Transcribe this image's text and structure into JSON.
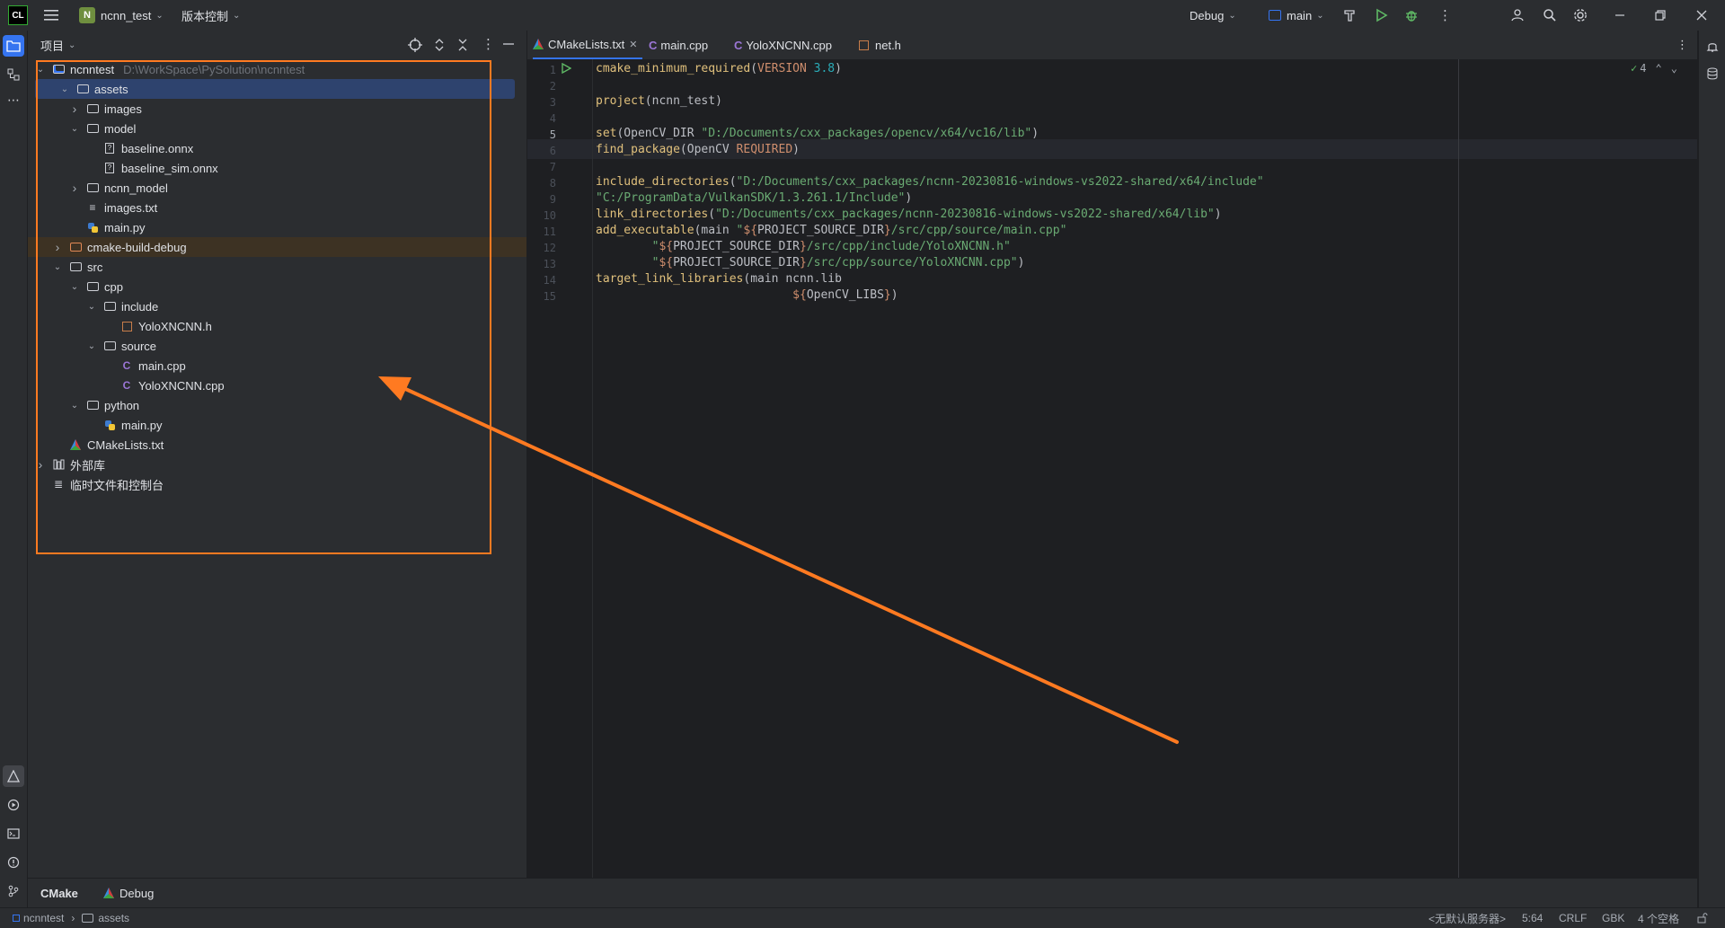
{
  "topbar": {
    "logo": "CL",
    "menu_icon": "hamburger-icon",
    "project_badge": "N",
    "project_name": "ncnn_test",
    "vcs_menu": "版本控制",
    "run_config": "Debug",
    "branch": "main"
  },
  "project_panel": {
    "title": "项目",
    "tree": [
      {
        "label": "ncnntest",
        "hint": "D:\\WorkSpace\\PySolution\\ncnntest",
        "level": 0,
        "arrow": "open",
        "icon": "module-folder"
      },
      {
        "label": "assets",
        "level": 1,
        "arrow": "open",
        "icon": "folder",
        "selected": true
      },
      {
        "label": "images",
        "level": 2,
        "arrow": "closed",
        "icon": "folder"
      },
      {
        "label": "model",
        "level": 2,
        "arrow": "open",
        "icon": "folder"
      },
      {
        "label": "baseline.onnx",
        "level": 3,
        "arrow": "none",
        "icon": "unknown-file"
      },
      {
        "label": "baseline_sim.onnx",
        "level": 3,
        "arrow": "none",
        "icon": "unknown-file"
      },
      {
        "label": "ncnn_model",
        "level": 2,
        "arrow": "closed",
        "icon": "folder"
      },
      {
        "label": "images.txt",
        "level": 2,
        "arrow": "none",
        "icon": "text-file"
      },
      {
        "label": "main.py",
        "level": 2,
        "arrow": "none",
        "icon": "python-file"
      },
      {
        "label": "cmake-build-debug",
        "level": 1,
        "arrow": "closed",
        "icon": "excluded-folder",
        "excluded": true
      },
      {
        "label": "src",
        "level": 1,
        "arrow": "open",
        "icon": "folder"
      },
      {
        "label": "cpp",
        "level": 2,
        "arrow": "open",
        "icon": "folder"
      },
      {
        "label": "include",
        "level": 3,
        "arrow": "open",
        "icon": "folder"
      },
      {
        "label": "YoloXNCNN.h",
        "level": 4,
        "arrow": "none",
        "icon": "header-file"
      },
      {
        "label": "source",
        "level": 3,
        "arrow": "open",
        "icon": "folder"
      },
      {
        "label": "main.cpp",
        "level": 4,
        "arrow": "none",
        "icon": "cpp-file"
      },
      {
        "label": "YoloXNCNN.cpp",
        "level": 4,
        "arrow": "none",
        "icon": "cpp-file"
      },
      {
        "label": "python",
        "level": 2,
        "arrow": "open",
        "icon": "folder"
      },
      {
        "label": "main.py",
        "level": 3,
        "arrow": "none",
        "icon": "python-file"
      },
      {
        "label": "CMakeLists.txt",
        "level": 1,
        "arrow": "none",
        "icon": "cmake-file"
      },
      {
        "label": "外部库",
        "level": 0,
        "arrow": "closed",
        "icon": "library"
      },
      {
        "label": "临时文件和控制台",
        "level": 0,
        "arrow": "none",
        "icon": "scratches"
      }
    ]
  },
  "tabs": [
    {
      "label": "CMakeLists.txt",
      "icon": "cmake-file",
      "active": true
    },
    {
      "label": "main.cpp",
      "icon": "cpp-file"
    },
    {
      "label": "YoloXNCNN.cpp",
      "icon": "cpp-file"
    },
    {
      "label": "net.h",
      "icon": "header-file"
    }
  ],
  "editor": {
    "inspection_count": "4",
    "lines": [
      "1",
      "2",
      "3",
      "4",
      "5",
      "6",
      "7",
      "8",
      "9",
      "10",
      "11",
      "12",
      "13",
      "14",
      "15"
    ]
  },
  "bottom_tabs": [
    "CMake",
    "Debug"
  ],
  "statusbar": {
    "breadcrumb_root": "ncnntest",
    "breadcrumb_child": "assets",
    "lang_server": "<无默认服务器>",
    "position": "5:64",
    "line_sep": "CRLF",
    "encoding": "GBK",
    "indent": "4 个空格"
  },
  "colors": {
    "annotation": "#ff7a21",
    "accent": "#3574f0"
  }
}
